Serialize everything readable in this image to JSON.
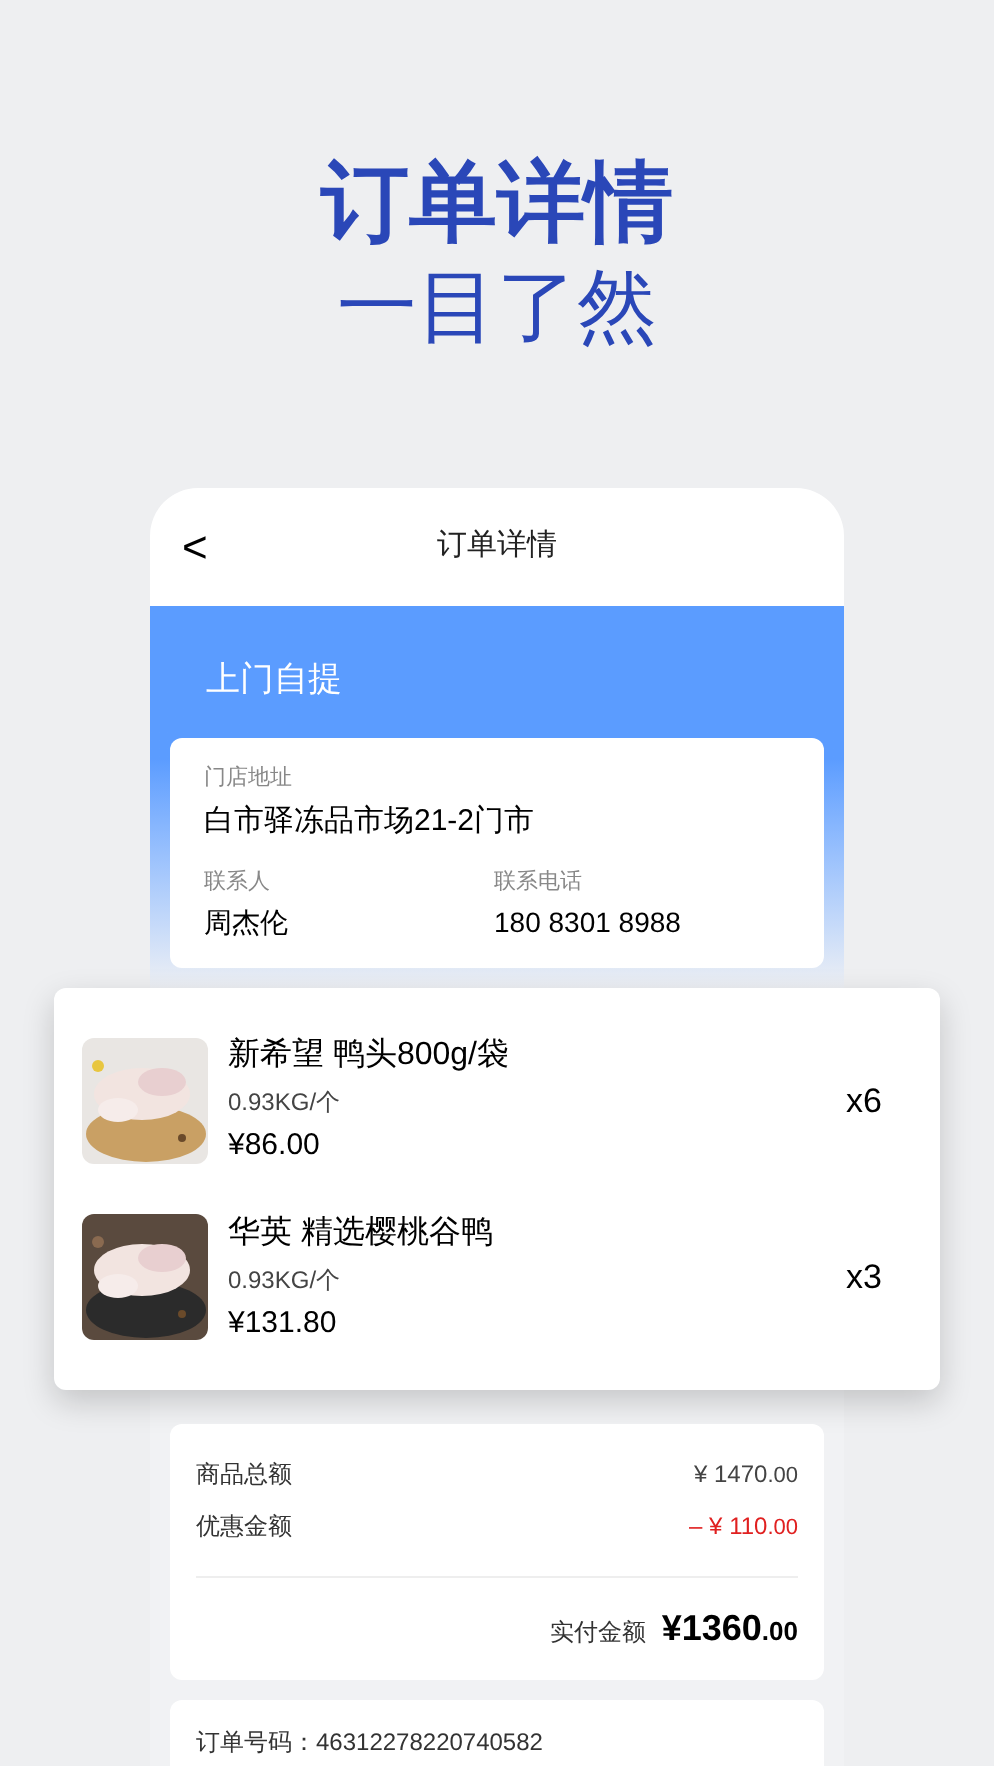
{
  "headline": {
    "title": "订单详情",
    "subtitle": "一目了然"
  },
  "nav": {
    "back": "<",
    "title": "订单详情"
  },
  "pickup": {
    "title": "上门自提",
    "address_label": "门店地址",
    "address": "白市驿冻品市场21-2门市",
    "contact_label": "联系人",
    "contact": "周杰伦",
    "phone_label": "联系电话",
    "phone": "180 8301 8988"
  },
  "products": [
    {
      "kind": "picture",
      "name": "新希望 鸭头800g/袋",
      "spec": "0.93KG/个",
      "price": "¥86.00",
      "qty": "x6"
    },
    {
      "kind": "picture",
      "name": "华英 精选樱桃谷鸭",
      "spec": "0.93KG/个",
      "price": "¥131.80",
      "qty": "x3"
    }
  ],
  "summary": {
    "rows": [
      {
        "label": "商品总额",
        "value": "¥ 1470",
        "cents": ".00",
        "kind": "normal"
      },
      {
        "label": "优惠金额",
        "value": "– ¥ 110",
        "cents": ".00",
        "kind": "discount"
      }
    ],
    "total_label": "实付金额",
    "total": "¥1360",
    "total_cents": ".00"
  },
  "order": {
    "label": "订单号码：",
    "number": "46312278220740582"
  }
}
